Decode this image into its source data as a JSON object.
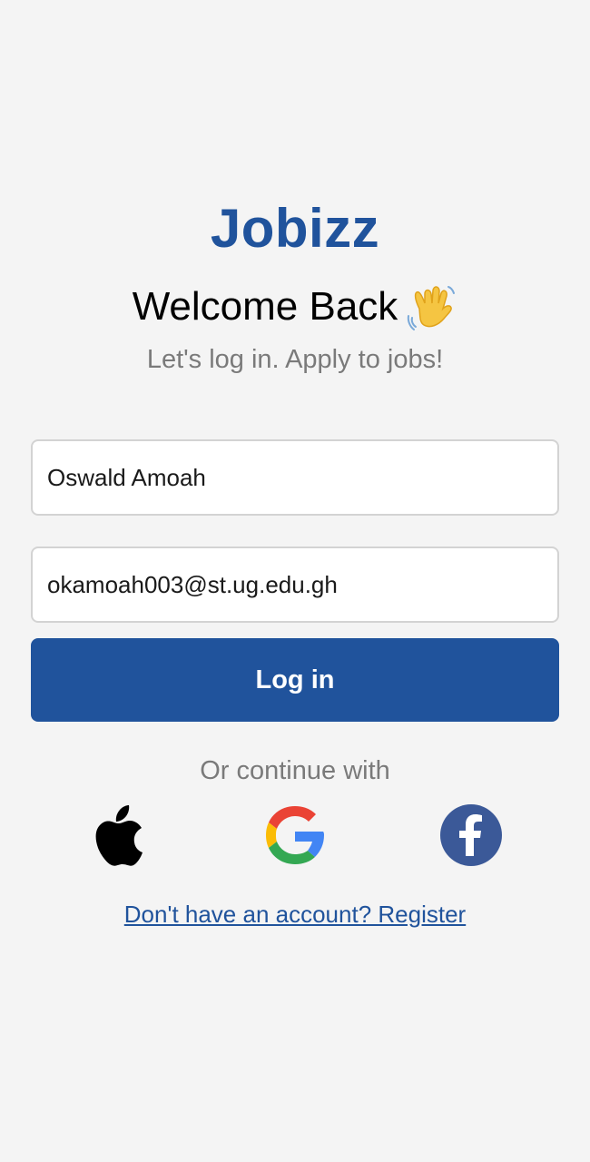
{
  "app": {
    "title": "Jobizz"
  },
  "header": {
    "welcome": "Welcome Back",
    "wave_icon": "waving-hand-icon",
    "subtitle": "Let's log in. Apply to jobs!"
  },
  "form": {
    "name_value": "Oswald Amoah",
    "email_value": "okamoah003@st.ug.edu.gh",
    "login_label": "Log in"
  },
  "social": {
    "divider": "Or continue with",
    "providers": [
      {
        "icon": "apple-icon"
      },
      {
        "icon": "google-icon"
      },
      {
        "icon": "facebook-icon"
      }
    ]
  },
  "footer": {
    "register_link": "Don't have an account? Register"
  },
  "colors": {
    "brand": "#20539c",
    "background": "#f4f4f4",
    "muted_text": "#7a7a7a",
    "facebook": "#3b5998"
  }
}
